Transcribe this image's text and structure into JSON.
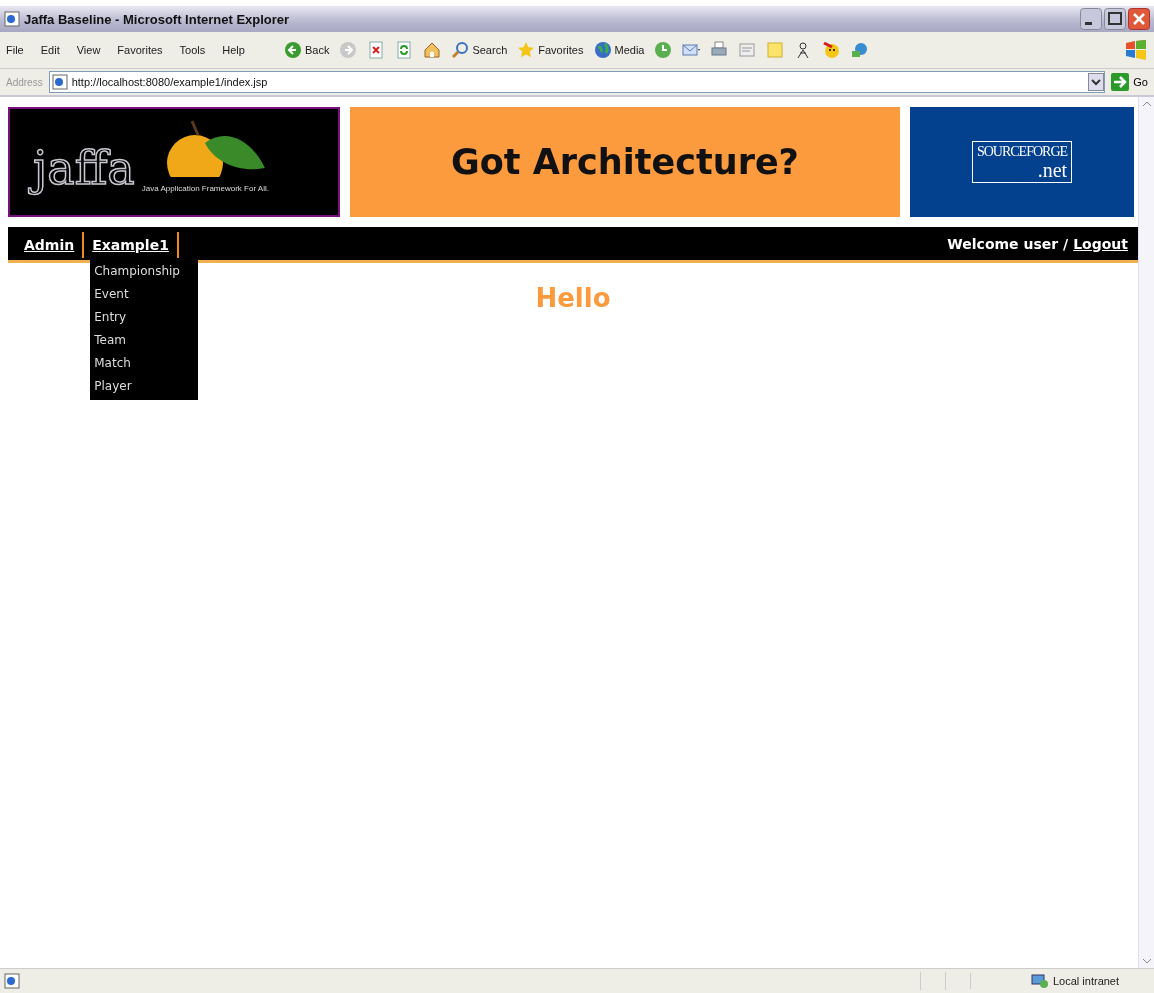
{
  "window": {
    "title": "Jaffa Baseline - Microsoft Internet Explorer"
  },
  "menu_bar": [
    "File",
    "Edit",
    "View",
    "Favorites",
    "Tools",
    "Help"
  ],
  "toolbar": [
    {
      "kind": "back",
      "label": "Back"
    },
    {
      "kind": "forward"
    },
    {
      "kind": "stop"
    },
    {
      "kind": "refresh"
    },
    {
      "kind": "home"
    },
    {
      "kind": "search",
      "label": "Search"
    },
    {
      "kind": "favorites",
      "label": "Favorites"
    },
    {
      "kind": "media",
      "label": "Media"
    },
    {
      "kind": "history"
    },
    {
      "kind": "mail"
    },
    {
      "kind": "print"
    },
    {
      "kind": "edit"
    },
    {
      "kind": "note"
    },
    {
      "kind": "messenger"
    },
    {
      "kind": "plugin"
    },
    {
      "kind": "network"
    }
  ],
  "address_bar": {
    "label": "Address",
    "value": "http://localhost:8080/example1/index.jsp",
    "go": "Go"
  },
  "page": {
    "logo": {
      "name": "jaffa",
      "tagline": "Java Application Framework For All."
    },
    "banner": "Got Architecture?",
    "partner": {
      "name": "SOURCEFORGE",
      "suffix": ".net"
    },
    "nav": [
      {
        "label": "Admin"
      },
      {
        "label": "Example1",
        "menu": [
          "Championship",
          "Event",
          "Entry",
          "Team",
          "Match",
          "Player"
        ]
      }
    ],
    "welcome": "Welcome user /",
    "logout": "Logout",
    "heading": "Hello"
  },
  "status_bar": {
    "zone": "Local intranet"
  }
}
